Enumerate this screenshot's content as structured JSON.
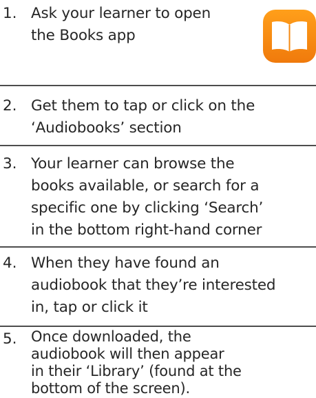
{
  "steps": [
    {
      "number": "1.",
      "lines": [
        "Ask your learner to open",
        "the Books app"
      ]
    },
    {
      "number": "2.",
      "lines": [
        "Get them to tap or click on the",
        "‘Audiobooks’ section"
      ]
    },
    {
      "number": "3.",
      "lines": [
        "Your learner can browse the",
        "books available, or search for a",
        "specific one by clicking ‘Search’",
        "in the bottom right-hand corner"
      ]
    },
    {
      "number": "4.",
      "lines": [
        "When they have found an",
        "audiobook that they’re interested",
        "in, tap or click it"
      ]
    },
    {
      "number": "5.",
      "lines": [
        "Once downloaded, the",
        "audiobook will then appear",
        "in their ‘Library’ (found at the",
        "bottom of the screen)."
      ]
    }
  ],
  "icon": {
    "name": "books-app-icon",
    "color_top": "#ff9f1a",
    "color_bottom": "#f07a0c"
  }
}
